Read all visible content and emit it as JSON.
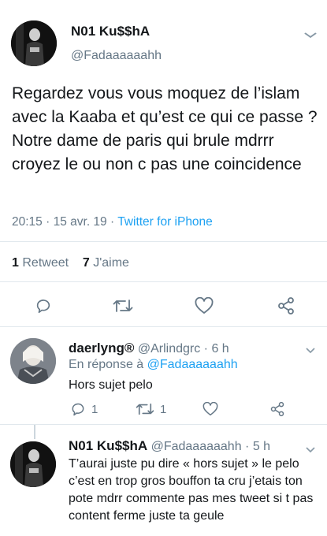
{
  "main_tweet": {
    "display_name": "N01 Ku$$hA",
    "handle": "@Fadaaaaaahh",
    "text": "Regardez vous vous moquez de l’islam avec la Kaaba et qu’est ce qui ce passe ? Notre dame de paris qui brule mdrrr croyez le ou non c pas une coincidence",
    "time": "20:15",
    "date": "15 avr. 19",
    "separator": "·",
    "source": "Twitter for iPhone",
    "retweets_count": "1",
    "retweets_label": "Retweet",
    "likes_count": "7",
    "likes_label": "J'aime"
  },
  "reply_1": {
    "display_name": "daerlyng®",
    "handle": "@Arlindgrc",
    "age": "· 6 h",
    "reply_prefix": "En réponse à",
    "reply_mention": "@Fadaaaaaahh",
    "text": "Hors sujet pelo",
    "reply_count": "1",
    "retweet_count": "1"
  },
  "reply_2": {
    "display_name": "N01 Ku$$hA",
    "handle": "@Fadaaaaaahh",
    "age": "· 5 h",
    "text": "T’aurai juste pu dire « hors sujet » le pelo c’est en trop gros bouffon ta cru j’etais ton pote mdrr commente pas mes tweet si t pas content ferme juste ta geule"
  },
  "icons": {
    "reply": "reply-icon",
    "retweet": "retweet-icon",
    "like": "heart-icon",
    "share": "share-icon",
    "more": "chevron-down-icon"
  },
  "colors": {
    "link": "#1da1f2",
    "secondary_text": "#657786",
    "divider": "#e1e8ed"
  }
}
